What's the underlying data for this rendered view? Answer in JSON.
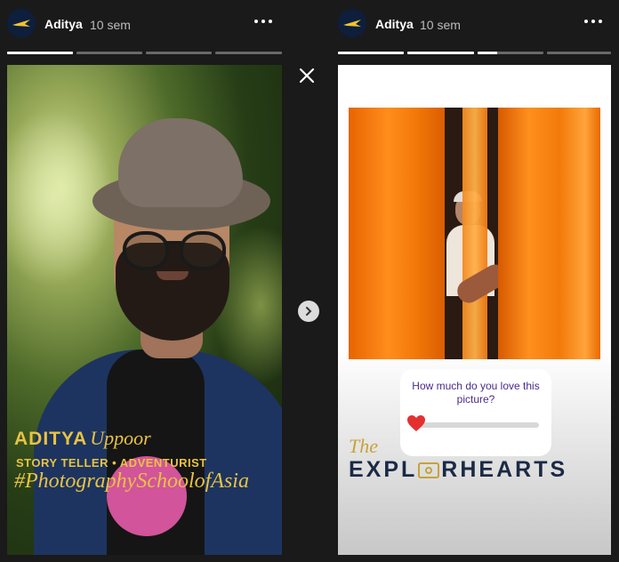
{
  "stories": [
    {
      "username": "Aditya",
      "time": "10 sem",
      "progress": [
        1,
        0,
        0,
        0
      ],
      "overlay": {
        "name_bold": "ADITYA",
        "name_script": "Uppoor",
        "tagline": "STORY TELLER • ADVENTURIST",
        "hashtag": "#PhotographySchoolofAsia"
      }
    },
    {
      "username": "Aditya",
      "time": "10 sem",
      "progress": [
        1,
        1,
        0.3,
        0,
        0
      ],
      "poll": {
        "question": "How much do you love this picture?",
        "emoji": "heart",
        "value": 0.05
      },
      "brand": {
        "the": "The",
        "word_before": "EXPL",
        "word_after": "RHEARTS"
      }
    }
  ],
  "icons": {
    "close": "close-icon",
    "next": "chevron-right-icon",
    "more": "more-horizontal-icon"
  },
  "colors": {
    "background": "#1a1a1a",
    "accent_gold": "#e8c341",
    "poll_text": "#4a2b8c",
    "brand_navy": "#1a2a45"
  }
}
